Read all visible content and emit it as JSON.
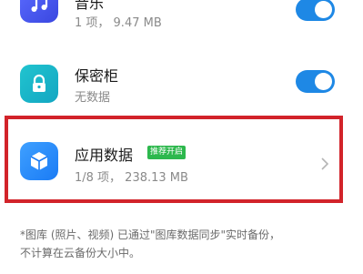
{
  "items": [
    {
      "icon": "music-icon",
      "title": "音乐",
      "subtitle": "1 项， 9.47 MB",
      "toggle_on": true
    },
    {
      "icon": "lock-icon",
      "title": "保密柜",
      "subtitle": "无数据",
      "toggle_on": true
    },
    {
      "icon": "cube-icon",
      "title": "应用数据",
      "badge": "推荐开启",
      "subtitle": "1/8 项， 238.13 MB"
    }
  ],
  "note": {
    "line1": "*图库 (照片、视频) 已通过\"图库数据同步\"实时备份，",
    "line2": "不计算在云备份大小中。"
  },
  "colors": {
    "toggle": "#1e88e5",
    "highlight": "#d2232a",
    "badge": "#2db84d"
  }
}
